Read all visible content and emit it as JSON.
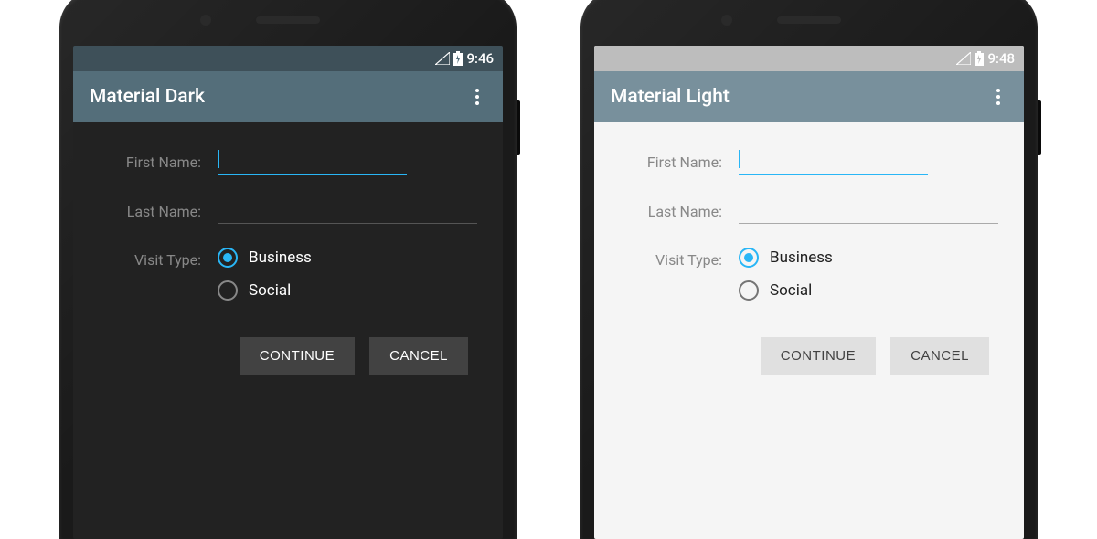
{
  "phones": {
    "dark": {
      "statusBar": {
        "time": "9:46"
      },
      "appBar": {
        "title": "Material Dark"
      },
      "form": {
        "firstNameLabel": "First Name:",
        "firstNameValue": "",
        "lastNameLabel": "Last Name:",
        "lastNameValue": "",
        "visitTypeLabel": "Visit Type:",
        "radioOptions": {
          "business": "Business",
          "social": "Social"
        },
        "buttons": {
          "continue": "CONTINUE",
          "cancel": "CANCEL"
        }
      }
    },
    "light": {
      "statusBar": {
        "time": "9:48"
      },
      "appBar": {
        "title": "Material Light"
      },
      "form": {
        "firstNameLabel": "First Name:",
        "firstNameValue": "",
        "lastNameLabel": "Last Name:",
        "lastNameValue": "",
        "visitTypeLabel": "Visit Type:",
        "radioOptions": {
          "business": "Business",
          "social": "Social"
        },
        "buttons": {
          "continue": "CONTINUE",
          "cancel": "CANCEL"
        }
      }
    }
  },
  "colors": {
    "accent": "#29b6f6",
    "darkAppBar": "#546e7a",
    "lightAppBar": "#78909c"
  }
}
